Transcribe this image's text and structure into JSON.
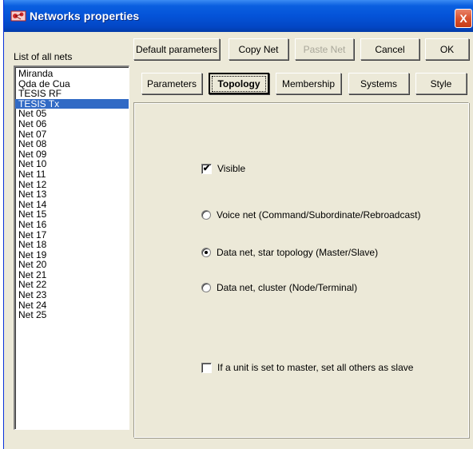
{
  "window": {
    "title": "Networks properties",
    "close_glyph": "X",
    "icon": "network-icon",
    "titlebar_color": "#0453d8",
    "selection_color": "#316ac5"
  },
  "list": {
    "label": "List of all nets",
    "selected_index": 3,
    "items": [
      "Miranda",
      "Qda de Cua",
      "TESIS RF",
      "TESIS Tx",
      "Net 05",
      "Net 06",
      "Net 07",
      "Net 08",
      "Net 09",
      "Net 10",
      "Net 11",
      "Net 12",
      "Net 13",
      "Net 14",
      "Net 15",
      "Net 16",
      "Net 17",
      "Net 18",
      "Net 19",
      "Net 20",
      "Net 21",
      "Net 22",
      "Net 23",
      "Net 24",
      "Net 25"
    ]
  },
  "toolbar": {
    "default_params": "Default parameters",
    "copy_net": "Copy Net",
    "paste_net": "Paste Net",
    "cancel": "Cancel",
    "ok": "OK"
  },
  "tabs": {
    "active": "topology",
    "parameters": "Parameters",
    "topology": "Topology",
    "membership": "Membership",
    "systems": "Systems",
    "style": "Style"
  },
  "topology": {
    "visible": {
      "label": "Visible",
      "checked": true
    },
    "radio_voice": {
      "label": "Voice net (Command/Subordinate/Rebroadcast)",
      "checked": false
    },
    "radio_star": {
      "label": "Data net, star topology (Master/Slave)",
      "checked": true
    },
    "radio_cluster": {
      "label": "Data net, cluster (Node/Terminal)",
      "checked": false
    },
    "master_slave": {
      "label": "If a unit is set to master, set all others as slave",
      "checked": false
    }
  }
}
